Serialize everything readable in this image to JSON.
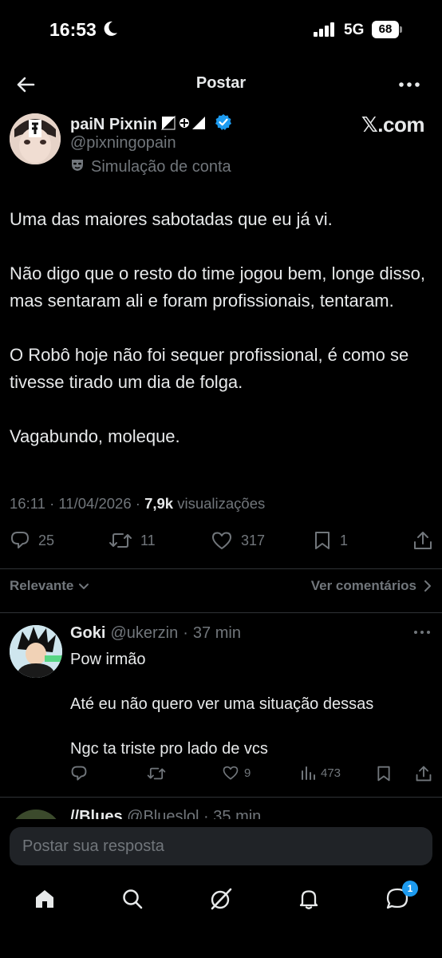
{
  "status_bar": {
    "time": "16:53",
    "network": "5G",
    "battery": "68"
  },
  "nav": {
    "title": "Postar"
  },
  "author": {
    "name": "paiN Pixnin",
    "handle": "@pixningopain",
    "simulation_label": "Simulação de conta",
    "brand": "𝕏.com"
  },
  "post": {
    "paragraphs": [
      "Uma das maiores sabotadas que eu já vi.",
      "Não digo que o resto do time jogou bem, longe disso, mas sentaram ali e foram profissionais, tentaram.",
      "O Robô hoje não foi sequer profissional, é como se tivesse tirado um dia de folga.",
      "Vagabundo, moleque."
    ],
    "time": "16:11",
    "date": "11/04/2026",
    "views": "7,9k",
    "views_label": "visualizações",
    "stats": {
      "replies": "25",
      "reposts": "11",
      "likes": "317",
      "bookmarks": "1"
    }
  },
  "sort": {
    "label": "Relevante",
    "view_comments": "Ver comentários"
  },
  "reply": {
    "name": "Goki",
    "handle": "@ukerzin",
    "time": "37 min",
    "paragraphs": [
      "Pow irmão",
      "Até eu não quero ver uma situação dessas",
      "Ngc ta triste pro lado de vcs"
    ],
    "stats": {
      "likes": "9",
      "views": "473"
    }
  },
  "next_reply": {
    "name": "//Blues",
    "handle": "@Blueslol",
    "time": "35 min"
  },
  "compose": {
    "placeholder": "Postar sua resposta"
  },
  "tabbar": {
    "messages_badge": "1"
  },
  "colors": {
    "accent": "#1d9bf0",
    "muted": "#71767b",
    "text": "#e7e9ea",
    "background": "#000000"
  }
}
